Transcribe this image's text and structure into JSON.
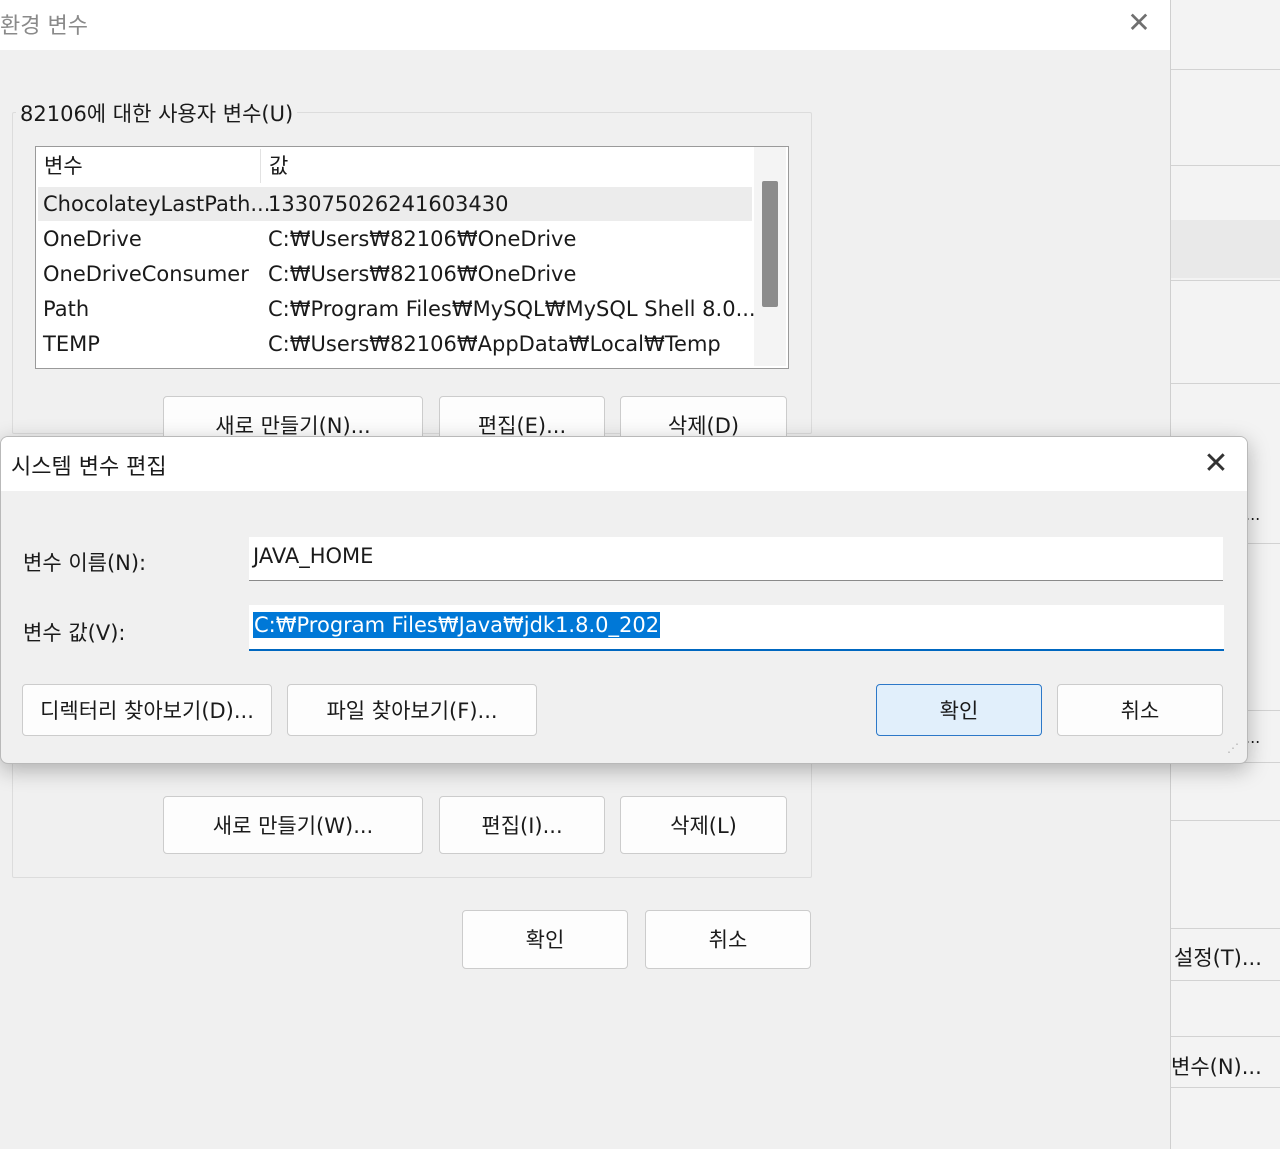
{
  "background_window": {
    "settings_label": "설정(T)...",
    "env_vars_label": "변수(N)...",
    "ellipsis_1": "...",
    "ellipsis_2": "..."
  },
  "env_dialog": {
    "title": "환경 변수",
    "close_icon": "close-icon",
    "user_vars": {
      "group_label": "82106에 대한 사용자 변수(U)",
      "columns": [
        "변수",
        "값"
      ],
      "rows": [
        {
          "name": "ChocolateyLastPath...",
          "value": "133075026241603430"
        },
        {
          "name": "OneDrive",
          "value": "C:₩Users₩82106₩OneDrive"
        },
        {
          "name": "OneDriveConsumer",
          "value": "C:₩Users₩82106₩OneDrive"
        },
        {
          "name": "Path",
          "value": "C:₩Program Files₩MySQL₩MySQL Shell 8.0..."
        },
        {
          "name": "TEMP",
          "value": "C:₩Users₩82106₩AppData₩Local₩Temp"
        }
      ],
      "new_label": "새로 만들기(N)...",
      "edit_label": "편집(E)...",
      "delete_label": "삭제(D)"
    },
    "system_vars": {
      "new_label": "새로 만들기(W)...",
      "edit_label": "편집(I)...",
      "delete_label": "삭제(L)"
    },
    "ok_label": "확인",
    "cancel_label": "취소"
  },
  "edit_dialog": {
    "title": "시스템 변수 편집",
    "close_icon": "close-icon",
    "name_label": "변수 이름(N):",
    "name_value": "JAVA_HOME",
    "value_label": "변수 값(V):",
    "value_value": "C:₩Program Files₩Java₩jdk1.8.0_202",
    "browse_dir_label": "디렉터리 찾아보기(D)...",
    "browse_file_label": "파일 찾아보기(F)...",
    "ok_label": "확인",
    "cancel_label": "취소"
  },
  "colors": {
    "accent": "#0067c0",
    "selection": "#0078d7",
    "ok_button_bg": "#e1effb"
  }
}
